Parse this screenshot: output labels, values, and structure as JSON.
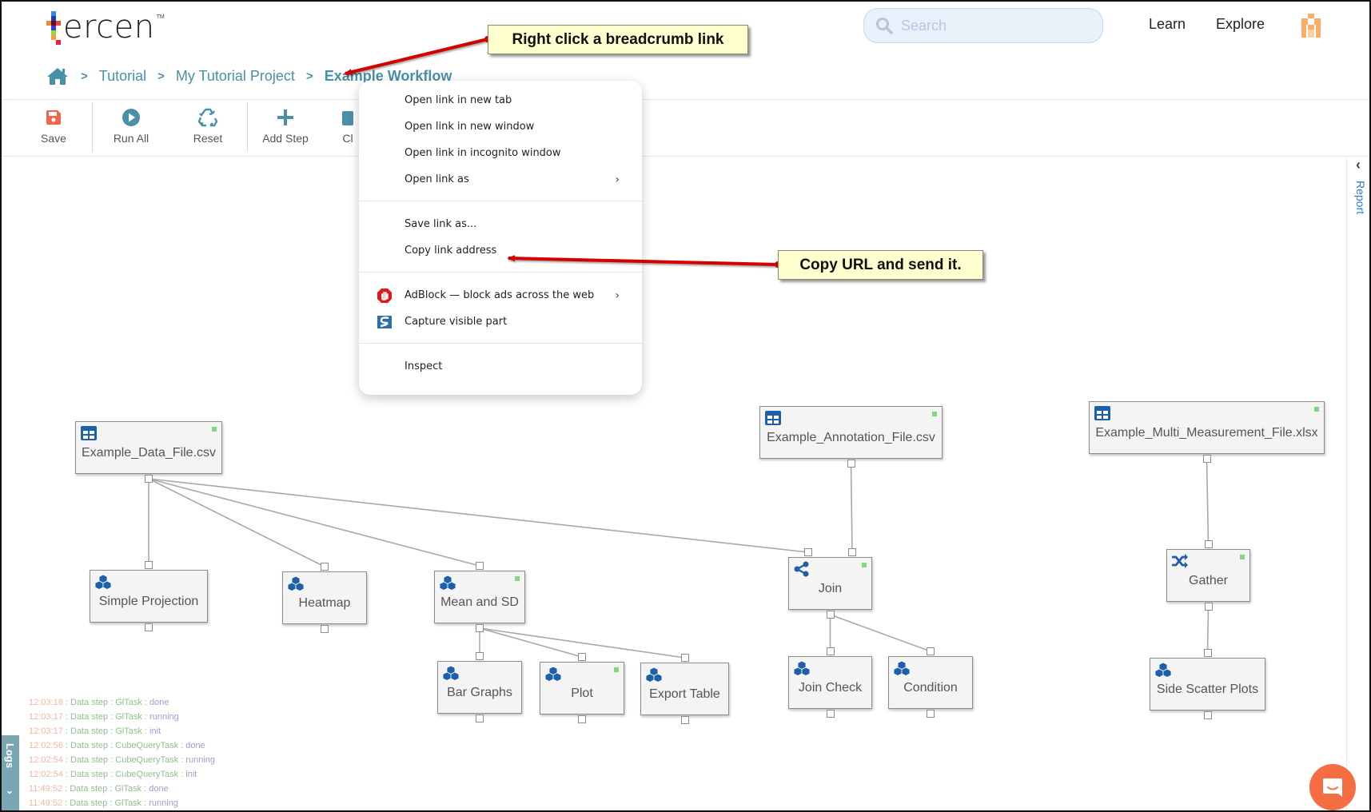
{
  "header": {
    "logo_text": "ercen",
    "logo_tm": "TM",
    "search_placeholder": "Search",
    "nav": [
      "Learn",
      "Explore"
    ]
  },
  "breadcrumb": {
    "items": [
      "Tutorial",
      "My Tutorial Project"
    ],
    "current": "Example Workflow",
    "separator": ">"
  },
  "toolbar": {
    "buttons": [
      {
        "label": "Save",
        "icon": "save-icon"
      },
      {
        "label": "Run All",
        "icon": "play-circle-icon"
      },
      {
        "label": "Reset",
        "icon": "recycle-icon"
      },
      {
        "label": "Add Step",
        "icon": "plus-icon"
      },
      {
        "label": "Cl",
        "icon": "clipboard-icon"
      }
    ]
  },
  "report_panel": {
    "label": "Report"
  },
  "workflow": {
    "nodes": [
      {
        "id": "data_file",
        "label": "Example_Data_File.csv",
        "type": "table",
        "status": "done"
      },
      {
        "id": "simple_projection",
        "label": "Simple Projection",
        "type": "cubes",
        "status": ""
      },
      {
        "id": "heatmap",
        "label": "Heatmap",
        "type": "cubes",
        "status": ""
      },
      {
        "id": "mean_sd",
        "label": "Mean and SD",
        "type": "cubes",
        "status": "done"
      },
      {
        "id": "bar_graphs",
        "label": "Bar Graphs",
        "type": "cubes",
        "status": ""
      },
      {
        "id": "plot",
        "label": "Plot",
        "type": "cubes",
        "status": "done"
      },
      {
        "id": "export_table",
        "label": "Export Table",
        "type": "cubes",
        "status": ""
      },
      {
        "id": "annotation_file",
        "label": "Example_Annotation_File.csv",
        "type": "table",
        "status": "done"
      },
      {
        "id": "join",
        "label": "Join",
        "type": "join",
        "status": "done"
      },
      {
        "id": "join_check",
        "label": "Join Check",
        "type": "cubes",
        "status": ""
      },
      {
        "id": "condition",
        "label": "Condition",
        "type": "cubes",
        "status": ""
      },
      {
        "id": "multi_file",
        "label": "Example_Multi_Measurement_File.xlsx",
        "type": "table",
        "status": "done"
      },
      {
        "id": "gather",
        "label": "Gather",
        "type": "gather",
        "status": "done"
      },
      {
        "id": "side_scatter",
        "label": "Side Scatter Plots",
        "type": "cubes",
        "status": ""
      }
    ],
    "links": [
      [
        "data_file",
        "simple_projection"
      ],
      [
        "data_file",
        "heatmap"
      ],
      [
        "data_file",
        "mean_sd"
      ],
      [
        "data_file",
        "join"
      ],
      [
        "mean_sd",
        "bar_graphs"
      ],
      [
        "mean_sd",
        "plot"
      ],
      [
        "mean_sd",
        "export_table"
      ],
      [
        "annotation_file",
        "join"
      ],
      [
        "join",
        "join_check"
      ],
      [
        "join",
        "condition"
      ],
      [
        "multi_file",
        "gather"
      ],
      [
        "gather",
        "side_scatter"
      ]
    ]
  },
  "logs": {
    "tab_label": "Logs",
    "entries": [
      {
        "time": "12:03:18",
        "message": "Data step : GlTask",
        "status": "done"
      },
      {
        "time": "12:03:17",
        "message": "Data step : GlTask",
        "status": "running"
      },
      {
        "time": "12:03:17",
        "message": "Data step : GlTask",
        "status": "init"
      },
      {
        "time": "12:02:56",
        "message": "Data step : CubeQueryTask",
        "status": "done"
      },
      {
        "time": "12:02:54",
        "message": "Data step : CubeQueryTask",
        "status": "running"
      },
      {
        "time": "12:02:54",
        "message": "Data step : CubeQueryTask",
        "status": "init"
      },
      {
        "time": "11:49:52",
        "message": "Data step : GlTask",
        "status": "done"
      },
      {
        "time": "11:49:52",
        "message": "Data step : GlTask",
        "status": "running"
      }
    ]
  },
  "context_menu": {
    "groups": [
      [
        {
          "label": "Open link in new tab"
        },
        {
          "label": "Open link in new window"
        },
        {
          "label": "Open link in incognito window"
        },
        {
          "label": "Open link as",
          "submenu": true
        }
      ],
      [
        {
          "label": "Save link as..."
        },
        {
          "label": "Copy link address"
        }
      ],
      [
        {
          "label": "AdBlock — block ads across the web",
          "icon": "adblock-icon",
          "submenu": true
        },
        {
          "label": "Capture visible part",
          "icon": "capture-icon"
        }
      ],
      [
        {
          "label": "Inspect"
        }
      ]
    ]
  },
  "annotations": {
    "callout_breadcrumb": "Right click a breadcrumb link",
    "callout_copy": "Copy URL and send it."
  },
  "colors": {
    "accent": "#4a90a8",
    "save": "#f0664a",
    "node_icon": "#1d5fa8",
    "status_done": "#7fd97f",
    "annotation_arrow": "#d40000",
    "callout_bg": "#ffffd0",
    "chat": "#f46d43"
  }
}
